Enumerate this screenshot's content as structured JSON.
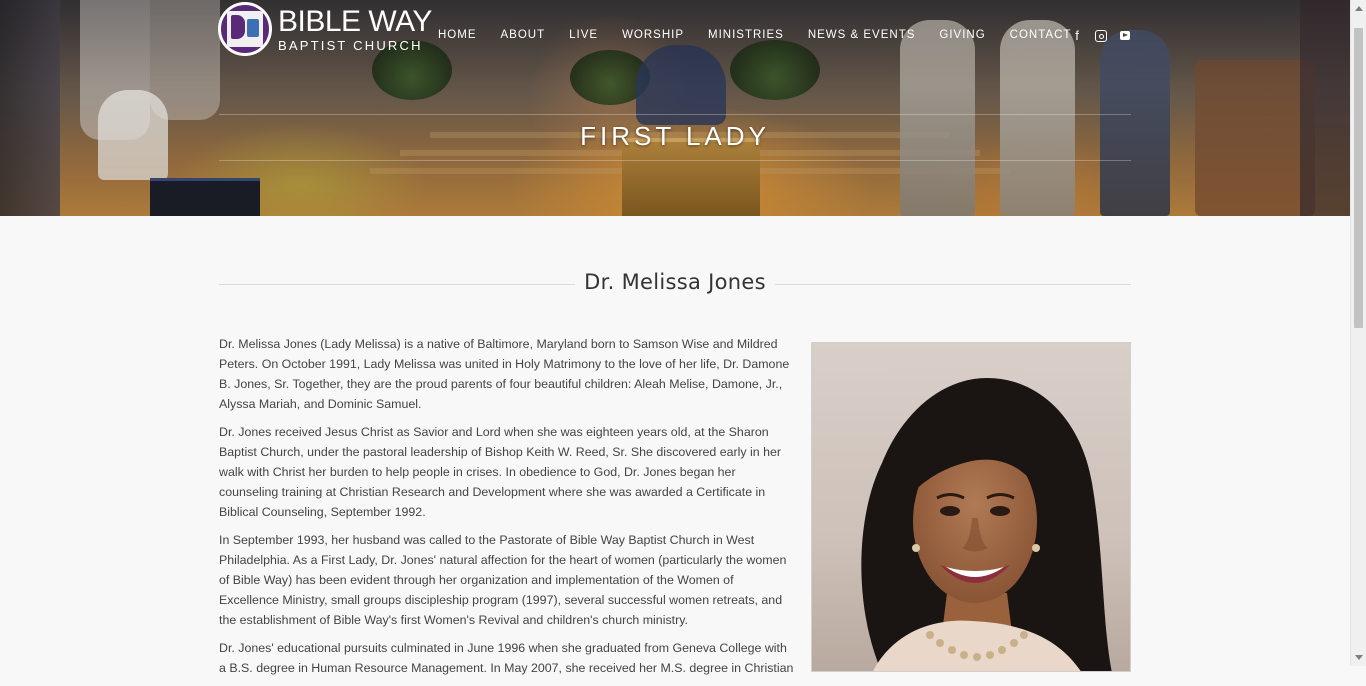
{
  "brand": {
    "name_line1": "BIBLE WAY",
    "name_line2": "BAPTIST CHURCH",
    "logo_color": "#5a2a78"
  },
  "nav": {
    "items": [
      "HOME",
      "ABOUT",
      "LIVE",
      "WORSHIP",
      "MINISTRIES",
      "NEWS & EVENTS",
      "GIVING",
      "CONTACT"
    ]
  },
  "social": {
    "icons": [
      "facebook-icon",
      "instagram-icon",
      "youtube-icon"
    ],
    "facebook_glyph": "f"
  },
  "hero": {
    "title": "FIRST LADY"
  },
  "section": {
    "title": "Dr. Melissa Jones"
  },
  "bio": {
    "paragraphs": [
      "Dr. Melissa Jones (Lady Melissa) is a native of Baltimore, Maryland born to Samson Wise and Mildred Peters. On October 1991, Lady Melissa was united in Holy Matrimony to the love of her life, Dr. Damone B. Jones, Sr. Together, they are the proud parents of four beautiful children: Aleah Melise, Damone, Jr., Alyssa Mariah, and Dominic Samuel.",
      "Dr. Jones received Jesus Christ as Savior and Lord when she was eighteen years old, at the Sharon Baptist Church, under the pastoral leadership of Bishop Keith W. Reed, Sr.  She discovered early in her walk with Christ her burden to help people in crises.  In obedience to God, Dr. Jones began her counseling training at Christian Research and Development where she was awarded a Certificate in Biblical Counseling, September 1992.",
      "In September 1993, her husband was called to the Pastorate of Bible Way Baptist Church in West Philadelphia.  As a First Lady, Dr. Jones' natural affection for the heart of women (particularly the women of Bible Way) has been evident through her organization and implementation of the Women of Excellence Ministry, small groups discipleship program (1997), several successful women retreats, and the establishment of Bible Way's first Women's Revival and children's church ministry.",
      "Dr. Jones' educational pursuits culminated in June 1996 when she graduated from Geneva College with a B.S. degree in Human Resource Management. In May 2007, she received her M.S. degree in Christian"
    ]
  },
  "colors": {
    "page_bg": "#f8f8f8",
    "text": "#444444",
    "heading": "#333333",
    "nav_text": "#ffffff"
  }
}
